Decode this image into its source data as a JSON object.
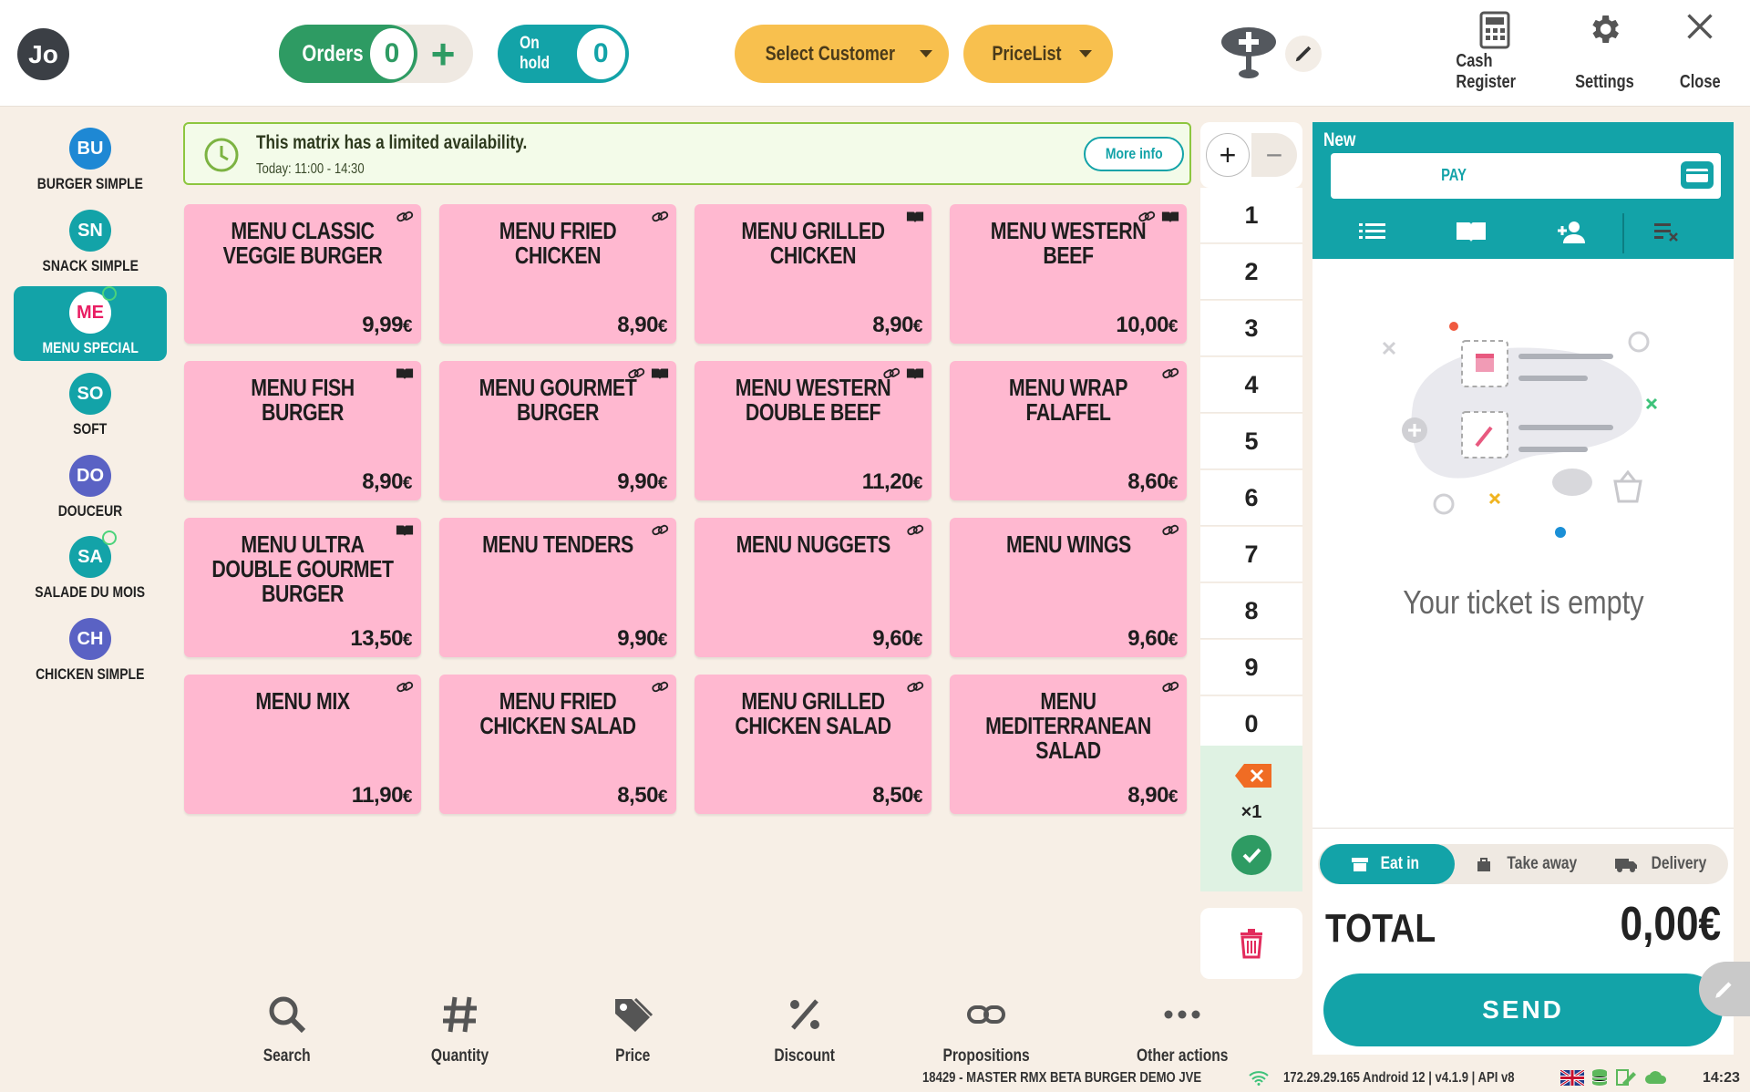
{
  "user": {
    "initials": "Jo"
  },
  "header": {
    "orders_label": "Orders",
    "orders_count": "0",
    "hold_label": "On hold",
    "hold_count": "0",
    "select_customer": "Select Customer",
    "pricelist": "PriceList",
    "cash_register": "Cash Register",
    "settings": "Settings",
    "close": "Close"
  },
  "categories": [
    {
      "abbr": "BU",
      "label": "BURGER SIMPLE",
      "color": "#1e88d4",
      "active": false
    },
    {
      "abbr": "SN",
      "label": "SNACK SIMPLE",
      "color": "#13a3a8",
      "active": false
    },
    {
      "abbr": "ME",
      "label": "MENU SPECIAL",
      "color": "#ffffff",
      "active": true
    },
    {
      "abbr": "SO",
      "label": "SOFT",
      "color": "#13a3a8",
      "active": false
    },
    {
      "abbr": "DO",
      "label": "DOUCEUR",
      "color": "#5a62c4",
      "active": false
    },
    {
      "abbr": "SA",
      "label": "SALADE DU MOIS",
      "color": "#13a3a8",
      "active": false
    },
    {
      "abbr": "CH",
      "label": "CHICKEN SIMPLE",
      "color": "#5a62c4",
      "active": false
    }
  ],
  "banner": {
    "title": "This matrix has a limited availability.",
    "subtitle": "Today: 11:00 - 14:30",
    "more_info": "More info"
  },
  "products": [
    {
      "name": "MENU CLASSIC VEGGIE BURGER",
      "price_main": "9,99",
      "price_unit": "€",
      "icons": [
        "link"
      ]
    },
    {
      "name": "MENU FRIED CHICKEN",
      "price_main": "8,90",
      "price_unit": "€",
      "icons": [
        "link"
      ]
    },
    {
      "name": "MENU GRILLED CHICKEN",
      "price_main": "8,90",
      "price_unit": "€",
      "icons": [
        "book"
      ]
    },
    {
      "name": "MENU WESTERN BEEF",
      "price_main": "10,00",
      "price_unit": "€",
      "icons": [
        "link",
        "book"
      ]
    },
    {
      "name": "MENU FISH BURGER",
      "price_main": "8,90",
      "price_unit": "€",
      "icons": [
        "book"
      ]
    },
    {
      "name": "MENU GOURMET BURGER",
      "price_main": "9,90",
      "price_unit": "€",
      "icons": [
        "link",
        "book"
      ]
    },
    {
      "name": "MENU WESTERN DOUBLE BEEF",
      "price_main": "11,20",
      "price_unit": "€",
      "icons": [
        "link",
        "book"
      ]
    },
    {
      "name": "MENU WRAP FALAFEL",
      "price_main": "8,60",
      "price_unit": "€",
      "icons": [
        "link"
      ]
    },
    {
      "name": "MENU ULTRA DOUBLE GOURMET BURGER",
      "price_main": "13,50",
      "price_unit": "€",
      "icons": [
        "book"
      ]
    },
    {
      "name": "MENU TENDERS",
      "price_main": "9,90",
      "price_unit": "€",
      "icons": [
        "link"
      ]
    },
    {
      "name": "MENU NUGGETS",
      "price_main": "9,60",
      "price_unit": "€",
      "icons": [
        "link"
      ]
    },
    {
      "name": "MENU WINGS",
      "price_main": "9,60",
      "price_unit": "€",
      "icons": [
        "link"
      ]
    },
    {
      "name": "MENU MIX",
      "price_main": "11,90",
      "price_unit": "€",
      "icons": [
        "link"
      ]
    },
    {
      "name": "MENU FRIED CHICKEN SALAD",
      "price_main": "8,50",
      "price_unit": "€",
      "icons": [
        "link"
      ]
    },
    {
      "name": "MENU GRILLED CHICKEN SALAD",
      "price_main": "8,50",
      "price_unit": "€",
      "icons": [
        "link"
      ]
    },
    {
      "name": "MENU MEDITERRANEAN SALAD",
      "price_main": "8,90",
      "price_unit": "€",
      "icons": [
        "link"
      ]
    }
  ],
  "numpad": {
    "plus": "+",
    "minus": "−",
    "digits": [
      "1",
      "2",
      "3",
      "4",
      "5",
      "6",
      "7",
      "8",
      "9",
      "0"
    ],
    "multiplier": "×1"
  },
  "ticket": {
    "title": "New",
    "pay": "PAY",
    "empty_text": "Your ticket is empty",
    "order_types": {
      "eat_in": "Eat in",
      "take_away": "Take away",
      "delivery": "Delivery"
    },
    "total_label": "TOTAL",
    "total_value": "0,00€",
    "send": "SEND"
  },
  "bottom_actions": {
    "search": "Search",
    "quantity": "Quantity",
    "price": "Price",
    "discount": "Discount",
    "propositions": "Propositions",
    "other": "Other actions"
  },
  "status": {
    "device": "18429 - MASTER RMX BETA BURGER DEMO JVE",
    "network": "172.29.29.165  Android 12  |  v4.1.9 | API v8",
    "time": "14:23"
  },
  "colors": {
    "teal": "#13a3a8",
    "green": "#2e9b63",
    "yellow": "#f8c04e",
    "tile_pink": "#ffb8d0",
    "background": "#f7efe6"
  },
  "icons": [
    "table-plus-icon",
    "pencil-icon",
    "calculator-icon",
    "gear-icon",
    "close-icon",
    "clock-icon",
    "link-icon",
    "book-icon",
    "backspace-icon",
    "check-icon",
    "trash-icon",
    "card-icon",
    "list-icon",
    "book-open-icon",
    "add-user-icon",
    "clear-list-icon",
    "store-icon",
    "bag-icon",
    "truck-icon",
    "search-icon",
    "hash-icon",
    "tag-icon",
    "percent-icon",
    "chain-icon",
    "more-icon",
    "wifi-icon",
    "uk-flag-icon",
    "database-icon",
    "sign-icon",
    "cloud-icon"
  ]
}
